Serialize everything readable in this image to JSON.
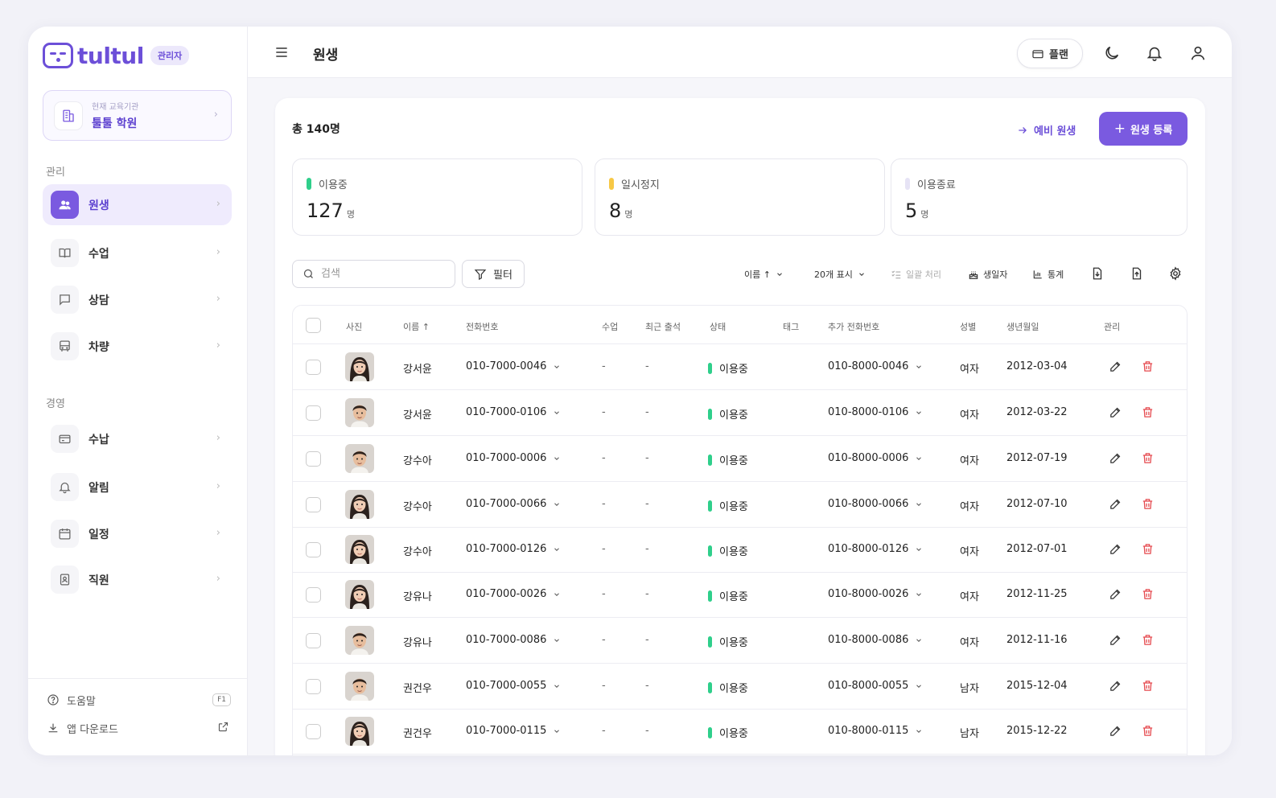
{
  "brand": {
    "logo": "tultul",
    "badge": "관리자"
  },
  "org": {
    "label": "현재 교육기관",
    "name": "툴툴 학원"
  },
  "sidebar": {
    "section_manage": "관리",
    "section_business": "경영",
    "items": [
      {
        "label": "원생",
        "icon": "users-icon"
      },
      {
        "label": "수업",
        "icon": "book-icon"
      },
      {
        "label": "상담",
        "icon": "chat-icon"
      },
      {
        "label": "차량",
        "icon": "bus-icon"
      },
      {
        "label": "수납",
        "icon": "card-icon"
      },
      {
        "label": "알림",
        "icon": "bell-icon"
      },
      {
        "label": "일정",
        "icon": "calendar-icon"
      },
      {
        "label": "직원",
        "icon": "id-badge-icon"
      }
    ],
    "help": "도움말",
    "help_key": "F1",
    "download": "앱 다운로드"
  },
  "header": {
    "title": "원생",
    "plan": "플랜"
  },
  "content": {
    "total": "총 140명",
    "pre_student": "예비 원생",
    "register": "원생 등록",
    "stats": [
      {
        "label": "이용중",
        "value": "127",
        "unit": "명",
        "color": "#2fcf8b"
      },
      {
        "label": "일시정지",
        "value": "8",
        "unit": "명",
        "color": "#f7c845"
      },
      {
        "label": "이용종료",
        "value": "5",
        "unit": "명",
        "color": "#e6e3f5"
      }
    ],
    "search_placeholder": "검색",
    "filter": "필터",
    "toolbar": {
      "sort": "이름 ↑",
      "page_size": "20개 표시",
      "bulk": "일괄 처리",
      "birthday": "생일자",
      "stats": "통계"
    }
  },
  "table": {
    "headers": {
      "photo": "사진",
      "name": "이름 ↑",
      "phone": "전화번호",
      "class": "수업",
      "attend": "최근 출석",
      "status": "상태",
      "tag": "태그",
      "phone2": "추가 전화번호",
      "gender": "성별",
      "birth": "생년월일",
      "manage": "관리"
    },
    "rows": [
      {
        "name": "강서윤",
        "phone": "010-7000-0046",
        "class": "-",
        "attend": "-",
        "status": "이용중",
        "phone2": "010-8000-0046",
        "gender": "여자",
        "birth": "2012-03-04",
        "face": "girl"
      },
      {
        "name": "강서윤",
        "phone": "010-7000-0106",
        "class": "-",
        "attend": "-",
        "status": "이용중",
        "phone2": "010-8000-0106",
        "gender": "여자",
        "birth": "2012-03-22",
        "face": "boy"
      },
      {
        "name": "강수아",
        "phone": "010-7000-0006",
        "class": "-",
        "attend": "-",
        "status": "이용중",
        "phone2": "010-8000-0006",
        "gender": "여자",
        "birth": "2012-07-19",
        "face": "boy"
      },
      {
        "name": "강수아",
        "phone": "010-7000-0066",
        "class": "-",
        "attend": "-",
        "status": "이용중",
        "phone2": "010-8000-0066",
        "gender": "여자",
        "birth": "2012-07-10",
        "face": "girl"
      },
      {
        "name": "강수아",
        "phone": "010-7000-0126",
        "class": "-",
        "attend": "-",
        "status": "이용중",
        "phone2": "010-8000-0126",
        "gender": "여자",
        "birth": "2012-07-01",
        "face": "girl"
      },
      {
        "name": "강유나",
        "phone": "010-7000-0026",
        "class": "-",
        "attend": "-",
        "status": "이용중",
        "phone2": "010-8000-0026",
        "gender": "여자",
        "birth": "2012-11-25",
        "face": "girl"
      },
      {
        "name": "강유나",
        "phone": "010-7000-0086",
        "class": "-",
        "attend": "-",
        "status": "이용중",
        "phone2": "010-8000-0086",
        "gender": "여자",
        "birth": "2012-11-16",
        "face": "boy"
      },
      {
        "name": "권건우",
        "phone": "010-7000-0055",
        "class": "-",
        "attend": "-",
        "status": "이용중",
        "phone2": "010-8000-0055",
        "gender": "남자",
        "birth": "2015-12-04",
        "face": "boy"
      },
      {
        "name": "권건우",
        "phone": "010-7000-0115",
        "class": "-",
        "attend": "-",
        "status": "이용중",
        "phone2": "010-8000-0115",
        "gender": "남자",
        "birth": "2015-12-22",
        "face": "girl"
      }
    ]
  }
}
